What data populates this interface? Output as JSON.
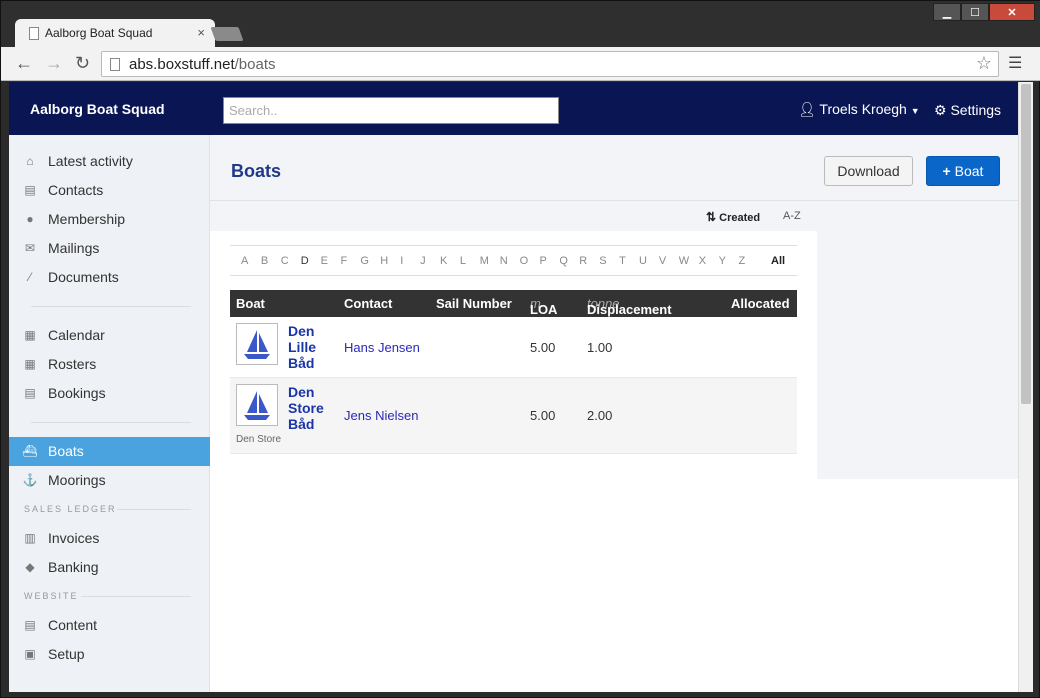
{
  "browser": {
    "tab_title": "Aalborg Boat Squad",
    "tab_close": "×",
    "url_host": "abs.boxstuff.net",
    "url_path": "/boats"
  },
  "navbar": {
    "brand": "Aalborg Boat Squad",
    "search_placeholder": "Search..",
    "user": "Troels Kroegh",
    "settings": "Settings"
  },
  "sidebar": {
    "items": [
      {
        "label": "Latest activity",
        "icon": "home-icon"
      },
      {
        "label": "Contacts",
        "icon": "contact-card-icon"
      },
      {
        "label": "Membership",
        "icon": "group-icon"
      },
      {
        "label": "Mailings",
        "icon": "mail-icon"
      },
      {
        "label": "Documents",
        "icon": "document-icon"
      },
      {
        "label": "Calendar",
        "icon": "calendar-icon"
      },
      {
        "label": "Rosters",
        "icon": "roster-icon"
      },
      {
        "label": "Bookings",
        "icon": "bookings-icon"
      },
      {
        "label": "Boats",
        "icon": "boat-icon",
        "active": true
      },
      {
        "label": "Moorings",
        "icon": "anchor-icon"
      },
      {
        "label": "Invoices",
        "icon": "invoices-icon"
      },
      {
        "label": "Banking",
        "icon": "banking-icon"
      },
      {
        "label": "Content",
        "icon": "content-icon"
      },
      {
        "label": "Setup",
        "icon": "setup-icon"
      }
    ],
    "headings": {
      "sales_ledger": "SALES LEDGER",
      "website": "WEBSITE"
    }
  },
  "main": {
    "title": "Boats",
    "download_label": "Download",
    "add_boat_label": "Boat",
    "sort": {
      "created": "Created",
      "az": "A-Z"
    },
    "alphabet": [
      "A",
      "B",
      "C",
      "D",
      "E",
      "F",
      "G",
      "H",
      "I",
      "J",
      "K",
      "L",
      "M",
      "N",
      "O",
      "P",
      "Q",
      "R",
      "S",
      "T",
      "U",
      "V",
      "W",
      "X",
      "Y",
      "Z"
    ],
    "alphabet_current": "D",
    "alphabet_all": "All",
    "table": {
      "columns": [
        "Boat",
        "Contact",
        "Sail Number",
        "LOA",
        "Displacement",
        "Allocated"
      ],
      "loa_unit": "m",
      "displacement_unit": "tonne",
      "rows": [
        {
          "name_lines": [
            "Den",
            "Lille",
            "Båd"
          ],
          "contact": "Hans Jensen",
          "sail_number": "",
          "loa": "5.00",
          "displacement": "1.00",
          "allocated": "",
          "sub": ""
        },
        {
          "name_lines": [
            "Den",
            "Store",
            "Båd"
          ],
          "contact": "Jens Nielsen",
          "sail_number": "",
          "loa": "5.00",
          "displacement": "2.00",
          "allocated": "",
          "sub": "Den Store"
        }
      ]
    }
  },
  "colors": {
    "navbar": "#0a1654",
    "active": "#4aa3df",
    "primary": "#0b66c9",
    "title": "#1f3a8a"
  }
}
